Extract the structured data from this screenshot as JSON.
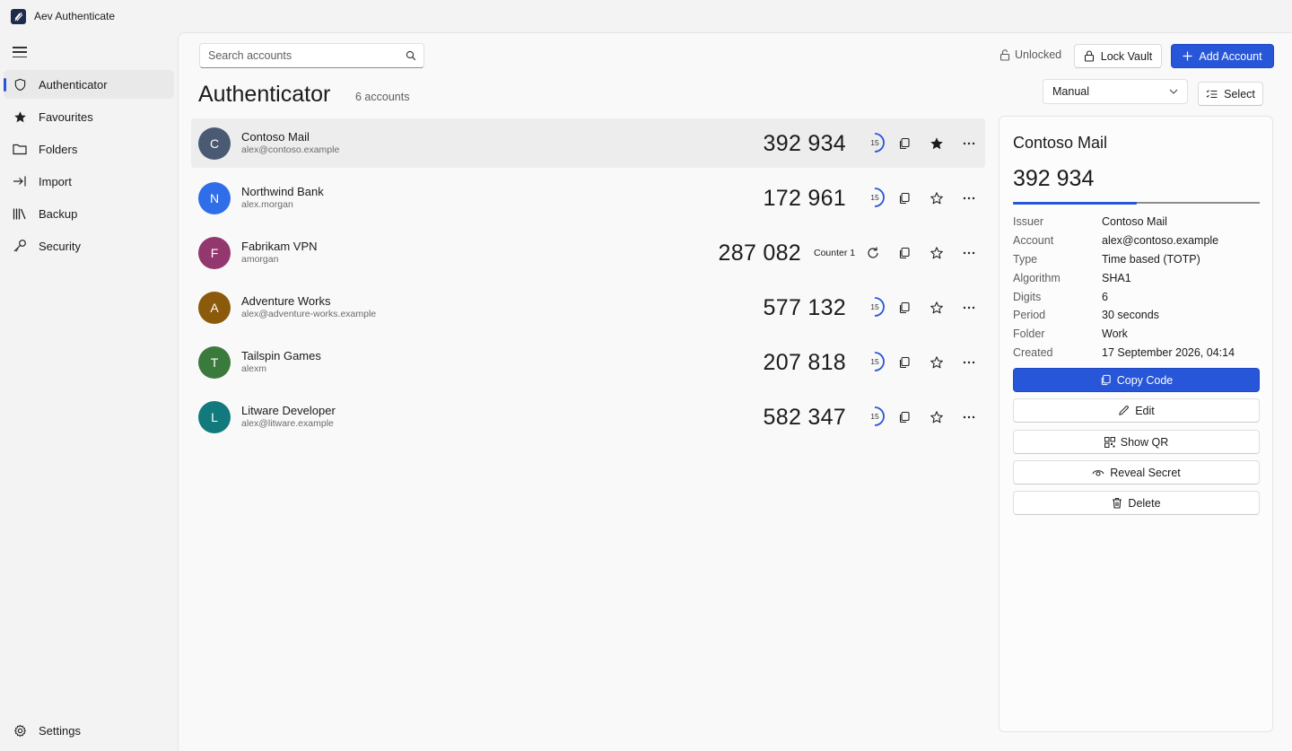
{
  "app": {
    "title": "Aev Authenticate"
  },
  "sidebar": {
    "items": [
      {
        "label": "Authenticator",
        "icon": "shield-icon"
      },
      {
        "label": "Favourites",
        "icon": "star-icon"
      },
      {
        "label": "Folders",
        "icon": "folder-icon"
      },
      {
        "label": "Import",
        "icon": "import-arrow-icon"
      },
      {
        "label": "Backup",
        "icon": "library-icon"
      },
      {
        "label": "Security",
        "icon": "key-icon"
      }
    ],
    "settings_label": "Settings"
  },
  "toolbar": {
    "search_placeholder": "Search accounts",
    "status": "Unlocked",
    "lock_label": "Lock Vault",
    "add_label": "Add Account"
  },
  "header": {
    "title": "Authenticator",
    "count": "6 accounts",
    "sort_value": "Manual",
    "select_label": "Select"
  },
  "accounts": [
    {
      "initial": "C",
      "name": "Contoso Mail",
      "user": "alex@contoso.example",
      "code": "392 934",
      "timer": "15",
      "color": "#4a5a73",
      "favourite": true
    },
    {
      "initial": "N",
      "name": "Northwind Bank",
      "user": "alex.morgan",
      "code": "172 961",
      "timer": "15",
      "color": "#2f6ee8",
      "favourite": false
    },
    {
      "initial": "F",
      "name": "Fabrikam VPN",
      "user": "amorgan",
      "code": "287 082",
      "counter": "Counter 1",
      "color": "#93386e",
      "favourite": false
    },
    {
      "initial": "A",
      "name": "Adventure Works",
      "user": "alex@adventure-works.example",
      "code": "577 132",
      "timer": "15",
      "color": "#8b5a0b",
      "favourite": false
    },
    {
      "initial": "T",
      "name": "Tailspin Games",
      "user": "alexm",
      "code": "207 818",
      "timer": "15",
      "color": "#3a7a3d",
      "favourite": false
    },
    {
      "initial": "L",
      "name": "Litware Developer",
      "user": "alex@litware.example",
      "code": "582 347",
      "timer": "15",
      "color": "#127a7d",
      "favourite": false
    }
  ],
  "details": {
    "title": "Contoso Mail",
    "code": "392 934",
    "progress_fraction": 0.5,
    "rows": [
      {
        "key": "Issuer",
        "value": "Contoso Mail"
      },
      {
        "key": "Account",
        "value": "alex@contoso.example"
      },
      {
        "key": "Type",
        "value": "Time based (TOTP)"
      },
      {
        "key": "Algorithm",
        "value": "SHA1"
      },
      {
        "key": "Digits",
        "value": "6"
      },
      {
        "key": "Period",
        "value": "30 seconds"
      },
      {
        "key": "Folder",
        "value": "Work"
      },
      {
        "key": "Created",
        "value": "17 September 2026, 04:14"
      }
    ],
    "buttons": {
      "copy": "Copy Code",
      "edit": "Edit",
      "qr": "Show QR",
      "reveal": "Reveal Secret",
      "delete": "Delete"
    }
  },
  "colors": {
    "accent": "#2756d8"
  }
}
